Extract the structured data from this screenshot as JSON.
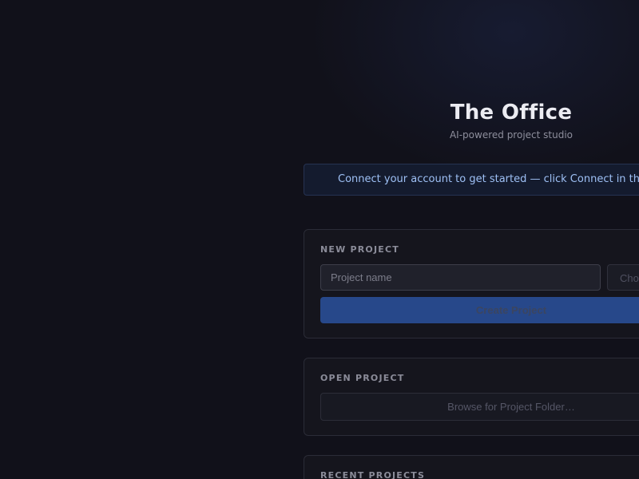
{
  "app": {
    "title": "The Office",
    "subtitle": "AI-powered project studio"
  },
  "banner": {
    "text": "Connect your account to get started — click Connect in th"
  },
  "new_project": {
    "label": "NEW PROJECT",
    "name_placeholder": "Project name",
    "choose_text": "Cho",
    "create_label": "Create Project"
  },
  "open_project": {
    "label": "OPEN PROJECT",
    "browse_label": "Browse for Project Folder…"
  },
  "recent_projects": {
    "label": "RECENT PROJECTS"
  },
  "colors": {
    "background": "#11111a",
    "accent": "#27488a",
    "banner_text": "#9ec0f5"
  }
}
